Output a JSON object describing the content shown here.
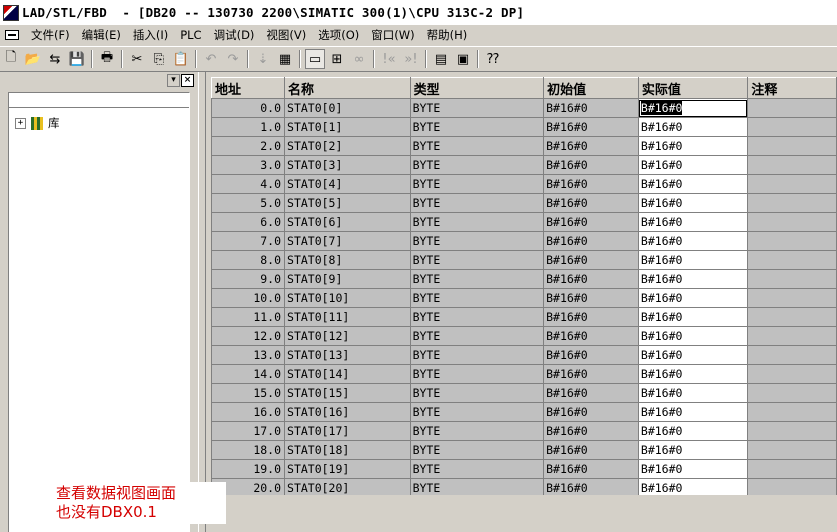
{
  "window": {
    "title": "LAD/STL/FBD  - [DB20 -- 130730 2200\\SIMATIC 300(1)\\CPU 313C-2 DP]"
  },
  "menu": {
    "items": [
      "文件(F)",
      "编辑(E)",
      "插入(I)",
      "PLC",
      "调试(D)",
      "视图(V)",
      "选项(O)",
      "窗口(W)",
      "帮助(H)"
    ]
  },
  "toolbar": {
    "buttons": [
      {
        "name": "new-icon",
        "glyph": "🗋",
        "enabled": true
      },
      {
        "name": "open-icon",
        "glyph": "📂",
        "enabled": true
      },
      {
        "name": "accessible-nodes-icon",
        "glyph": "⇆",
        "enabled": true
      },
      {
        "name": "save-icon",
        "glyph": "💾",
        "enabled": true
      },
      {
        "name": "sep"
      },
      {
        "name": "print-icon",
        "glyph": "🖶",
        "enabled": true
      },
      {
        "name": "sep"
      },
      {
        "name": "cut-icon",
        "glyph": "✂",
        "enabled": true
      },
      {
        "name": "copy-icon",
        "glyph": "⎘",
        "enabled": true
      },
      {
        "name": "paste-icon",
        "glyph": "📋",
        "enabled": false
      },
      {
        "name": "sep"
      },
      {
        "name": "undo-icon",
        "glyph": "↶",
        "enabled": false
      },
      {
        "name": "redo-icon",
        "glyph": "↷",
        "enabled": false
      },
      {
        "name": "sep"
      },
      {
        "name": "download-icon",
        "glyph": "⇣",
        "enabled": false
      },
      {
        "name": "monitor-cpu-icon",
        "glyph": "▦",
        "enabled": true
      },
      {
        "name": "sep"
      },
      {
        "name": "display-icon",
        "glyph": "▭",
        "enabled": true,
        "pressed": true
      },
      {
        "name": "network-icon",
        "glyph": "⊞",
        "enabled": true
      },
      {
        "name": "monitor-glasses-icon",
        "glyph": "∞",
        "enabled": false
      },
      {
        "name": "sep"
      },
      {
        "name": "first-network-icon",
        "glyph": "!«",
        "enabled": false
      },
      {
        "name": "last-network-icon",
        "glyph": "»!",
        "enabled": false
      },
      {
        "name": "sep"
      },
      {
        "name": "overview-icon",
        "glyph": "▤",
        "enabled": true
      },
      {
        "name": "details-icon",
        "glyph": "▣",
        "enabled": true
      },
      {
        "name": "sep"
      },
      {
        "name": "help-icon",
        "glyph": "⁇",
        "enabled": true
      }
    ]
  },
  "left_pane": {
    "tree_root": "库"
  },
  "table": {
    "headers": [
      "地址",
      "名称",
      "类型",
      "初始值",
      "实际值",
      "注释"
    ],
    "rows": [
      [
        "0.0",
        "STAT0[0]",
        "BYTE",
        "B#16#0",
        "B#16#0",
        ""
      ],
      [
        "1.0",
        "STAT0[1]",
        "BYTE",
        "B#16#0",
        "B#16#0",
        ""
      ],
      [
        "2.0",
        "STAT0[2]",
        "BYTE",
        "B#16#0",
        "B#16#0",
        ""
      ],
      [
        "3.0",
        "STAT0[3]",
        "BYTE",
        "B#16#0",
        "B#16#0",
        ""
      ],
      [
        "4.0",
        "STAT0[4]",
        "BYTE",
        "B#16#0",
        "B#16#0",
        ""
      ],
      [
        "5.0",
        "STAT0[5]",
        "BYTE",
        "B#16#0",
        "B#16#0",
        ""
      ],
      [
        "6.0",
        "STAT0[6]",
        "BYTE",
        "B#16#0",
        "B#16#0",
        ""
      ],
      [
        "7.0",
        "STAT0[7]",
        "BYTE",
        "B#16#0",
        "B#16#0",
        ""
      ],
      [
        "8.0",
        "STAT0[8]",
        "BYTE",
        "B#16#0",
        "B#16#0",
        ""
      ],
      [
        "9.0",
        "STAT0[9]",
        "BYTE",
        "B#16#0",
        "B#16#0",
        ""
      ],
      [
        "10.0",
        "STAT0[10]",
        "BYTE",
        "B#16#0",
        "B#16#0",
        ""
      ],
      [
        "11.0",
        "STAT0[11]",
        "BYTE",
        "B#16#0",
        "B#16#0",
        ""
      ],
      [
        "12.0",
        "STAT0[12]",
        "BYTE",
        "B#16#0",
        "B#16#0",
        ""
      ],
      [
        "13.0",
        "STAT0[13]",
        "BYTE",
        "B#16#0",
        "B#16#0",
        ""
      ],
      [
        "14.0",
        "STAT0[14]",
        "BYTE",
        "B#16#0",
        "B#16#0",
        ""
      ],
      [
        "15.0",
        "STAT0[15]",
        "BYTE",
        "B#16#0",
        "B#16#0",
        ""
      ],
      [
        "16.0",
        "STAT0[16]",
        "BYTE",
        "B#16#0",
        "B#16#0",
        ""
      ],
      [
        "17.0",
        "STAT0[17]",
        "BYTE",
        "B#16#0",
        "B#16#0",
        ""
      ],
      [
        "18.0",
        "STAT0[18]",
        "BYTE",
        "B#16#0",
        "B#16#0",
        ""
      ],
      [
        "19.0",
        "STAT0[19]",
        "BYTE",
        "B#16#0",
        "B#16#0",
        ""
      ],
      [
        "20.0",
        "STAT0[20]",
        "BYTE",
        "B#16#0",
        "B#16#0",
        ""
      ]
    ],
    "selected_row": 0,
    "selected_col": 4
  },
  "annotation": {
    "line1": "查看数据视图画面",
    "line2": "也没有DBX0.1",
    "color": "#d40000"
  }
}
